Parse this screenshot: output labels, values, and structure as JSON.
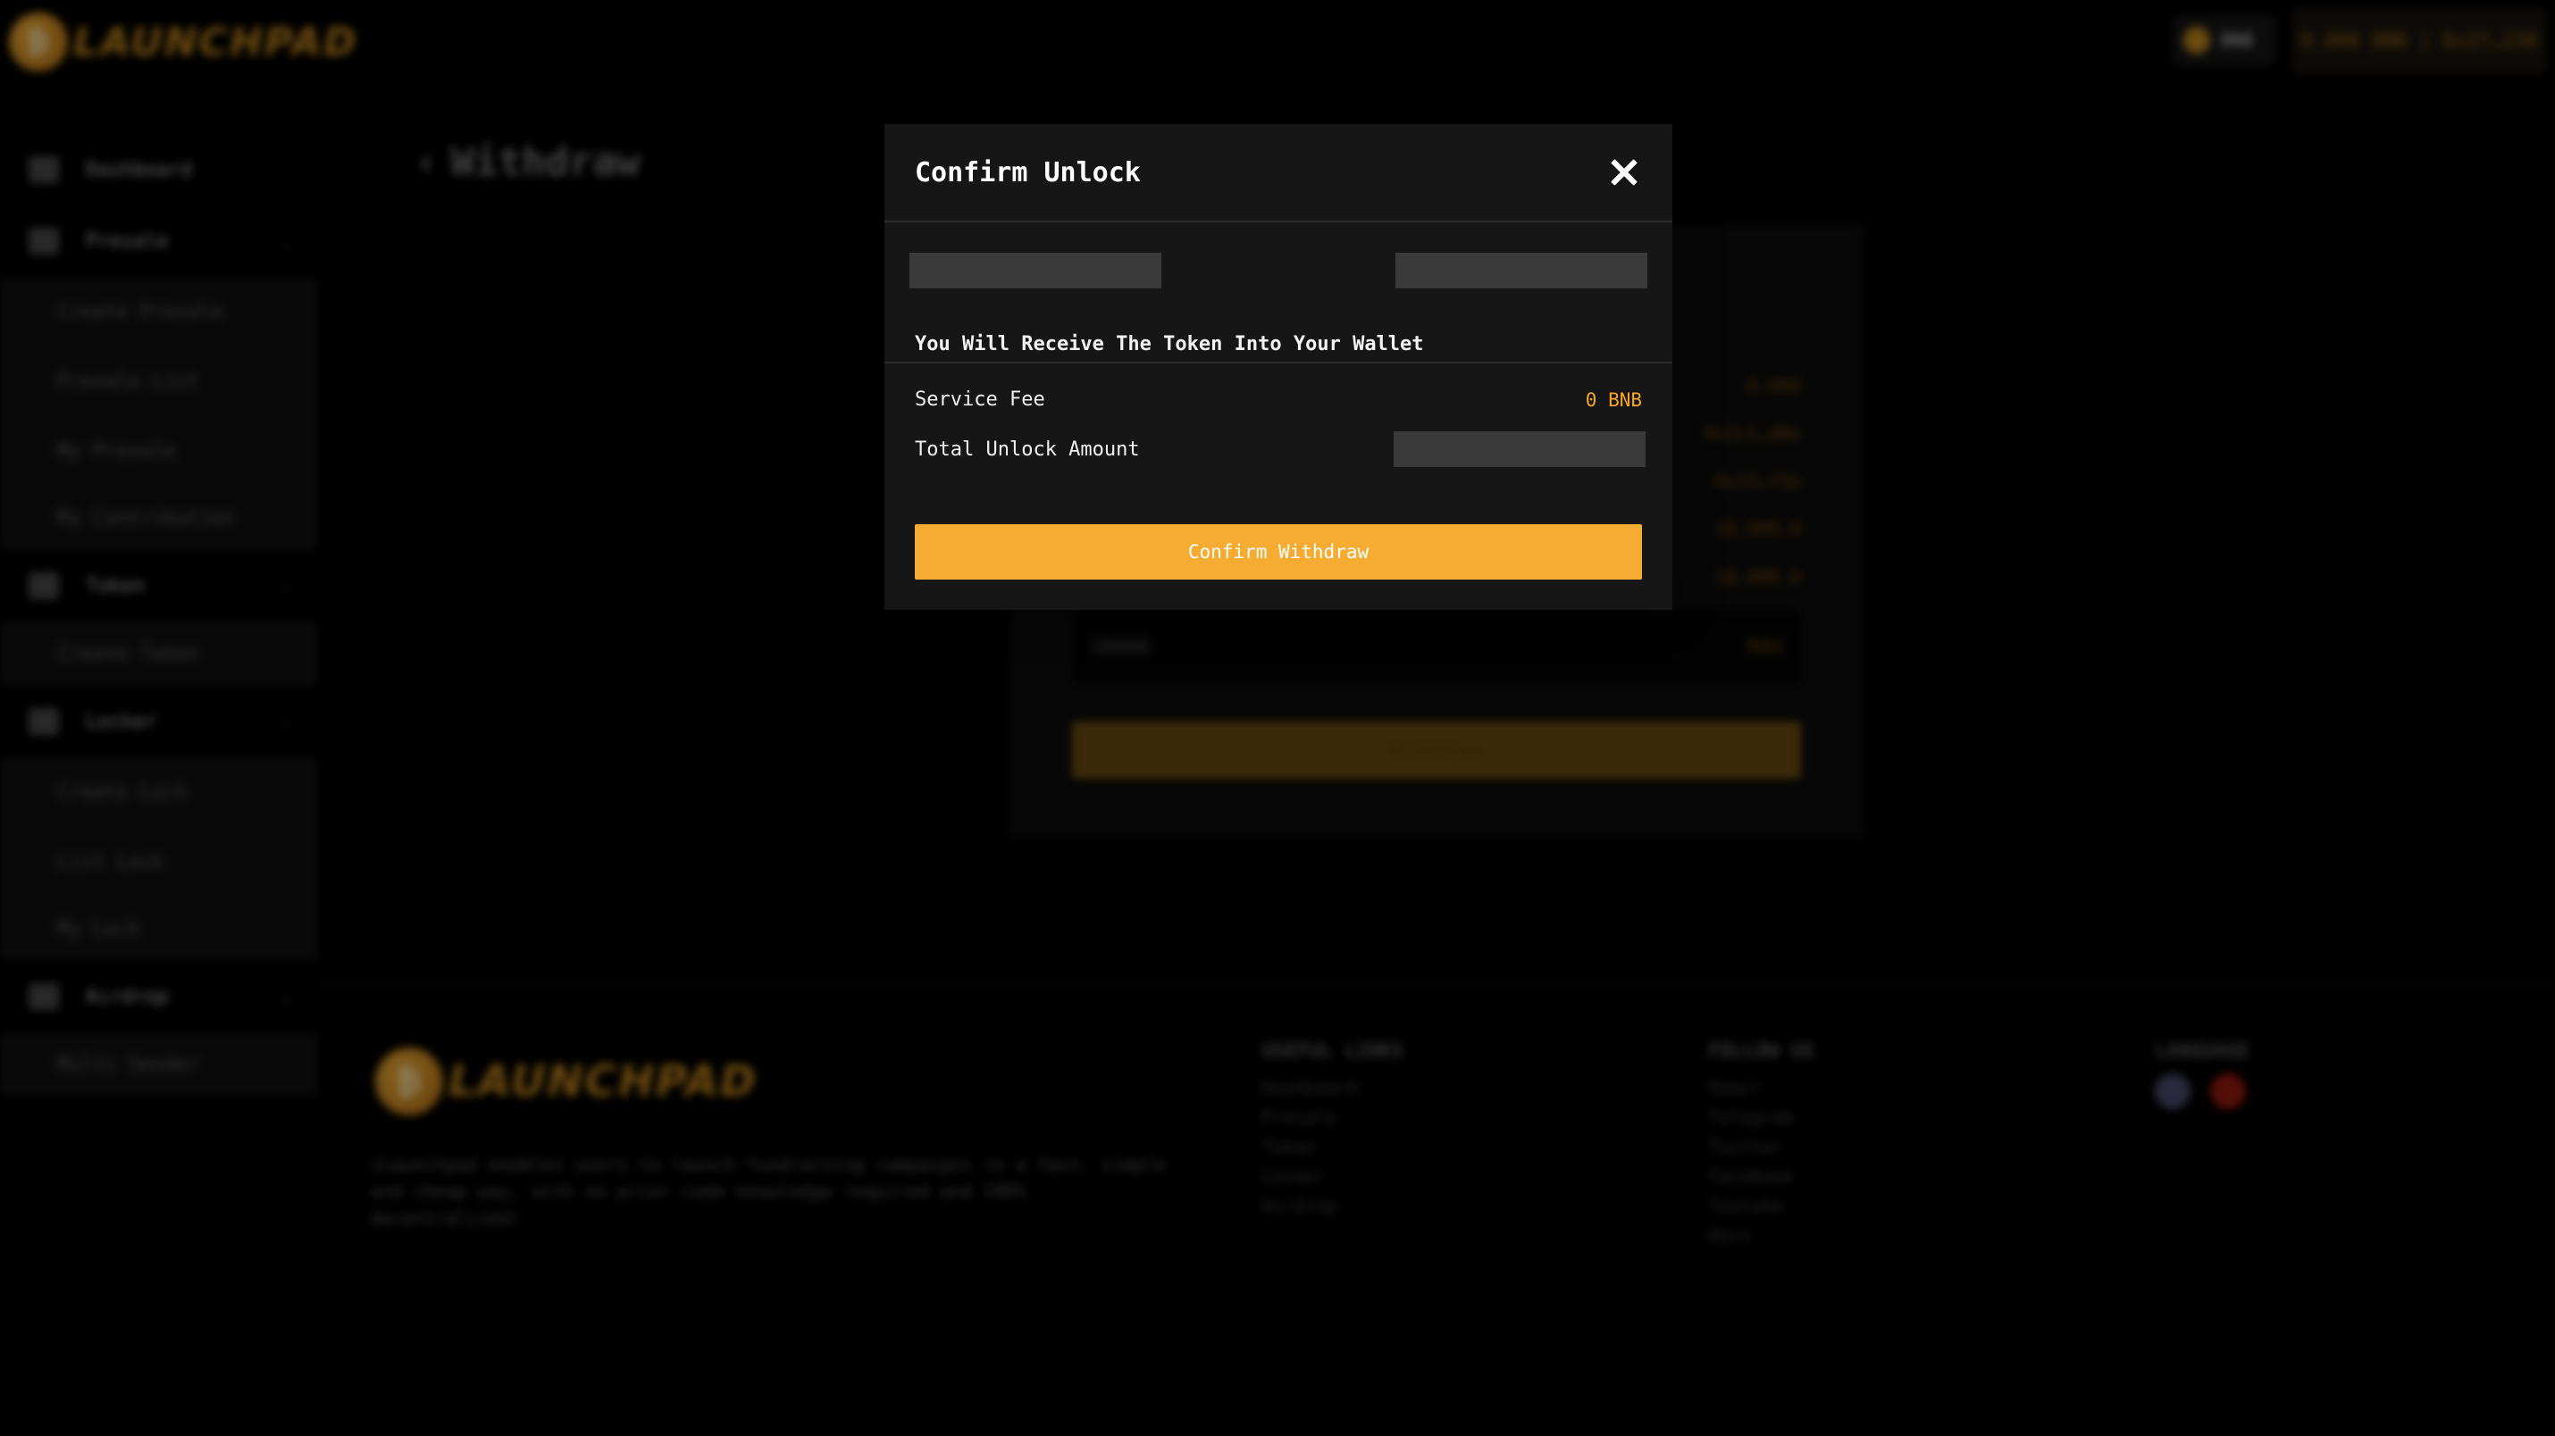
{
  "brand": {
    "name": "LAUNCHPAD",
    "coin_glyph": "₿"
  },
  "header": {
    "chain_label": "BNB",
    "wallet_label": "0.000 BNB | 0x2f…238"
  },
  "sidebar": {
    "items": [
      {
        "label": "Dashboard",
        "icon": "dashboard-icon"
      },
      {
        "label": "Presale",
        "icon": "rocket-icon",
        "children": [
          "Create Presale",
          "Presale List",
          "My Presale",
          "My Contribution"
        ]
      },
      {
        "label": "Token",
        "icon": "token-icon",
        "children": [
          "Create Token"
        ]
      },
      {
        "label": "Locker",
        "icon": "lock-icon",
        "children": [
          "Create Lock",
          "List Lock",
          "My Lock"
        ]
      },
      {
        "label": "Airdrop",
        "icon": "airdrop-icon",
        "children": [
          "Multi Sender"
        ]
      }
    ]
  },
  "page": {
    "back_glyph": "‹",
    "title": "Withdraw"
  },
  "card": {
    "values": [
      "0.000",
      "0x2c1…d0e",
      "0x13…f5b",
      "10,000.0",
      "10,000.0"
    ],
    "amount_placeholder": "10000",
    "amount_max": "MAX",
    "button_label": "Withdraw"
  },
  "footer": {
    "description": "iLaunchpad enables users to launch fundraising campaigns in a fast, simple and cheap way, with no prior code knowledge required and 100% decentralized!",
    "columns": [
      {
        "head": "USEFUL LINKS",
        "links": [
          "Dashboard",
          "Presale",
          "Token",
          "Locker",
          "Airdrop"
        ]
      },
      {
        "head": "FOLLOW US",
        "links": [
          "Email",
          "Telegram",
          "Twitter",
          "Facebook",
          "Youtube",
          "Docs"
        ]
      },
      {
        "head": "LANGUAGE",
        "flags": [
          "uk-flag",
          "china-flag"
        ]
      }
    ]
  },
  "modal": {
    "title": "Confirm Unlock",
    "note": "You Will Receive The Token Into Your Wallet",
    "service_fee_label": "Service Fee",
    "service_fee_value": "0 BNB",
    "total_label": "Total Unlock Amount",
    "confirm_label": "Confirm Withdraw"
  },
  "colors": {
    "accent": "#f6ac33",
    "fee": "#f5a623",
    "modal_bg": "#161616"
  }
}
